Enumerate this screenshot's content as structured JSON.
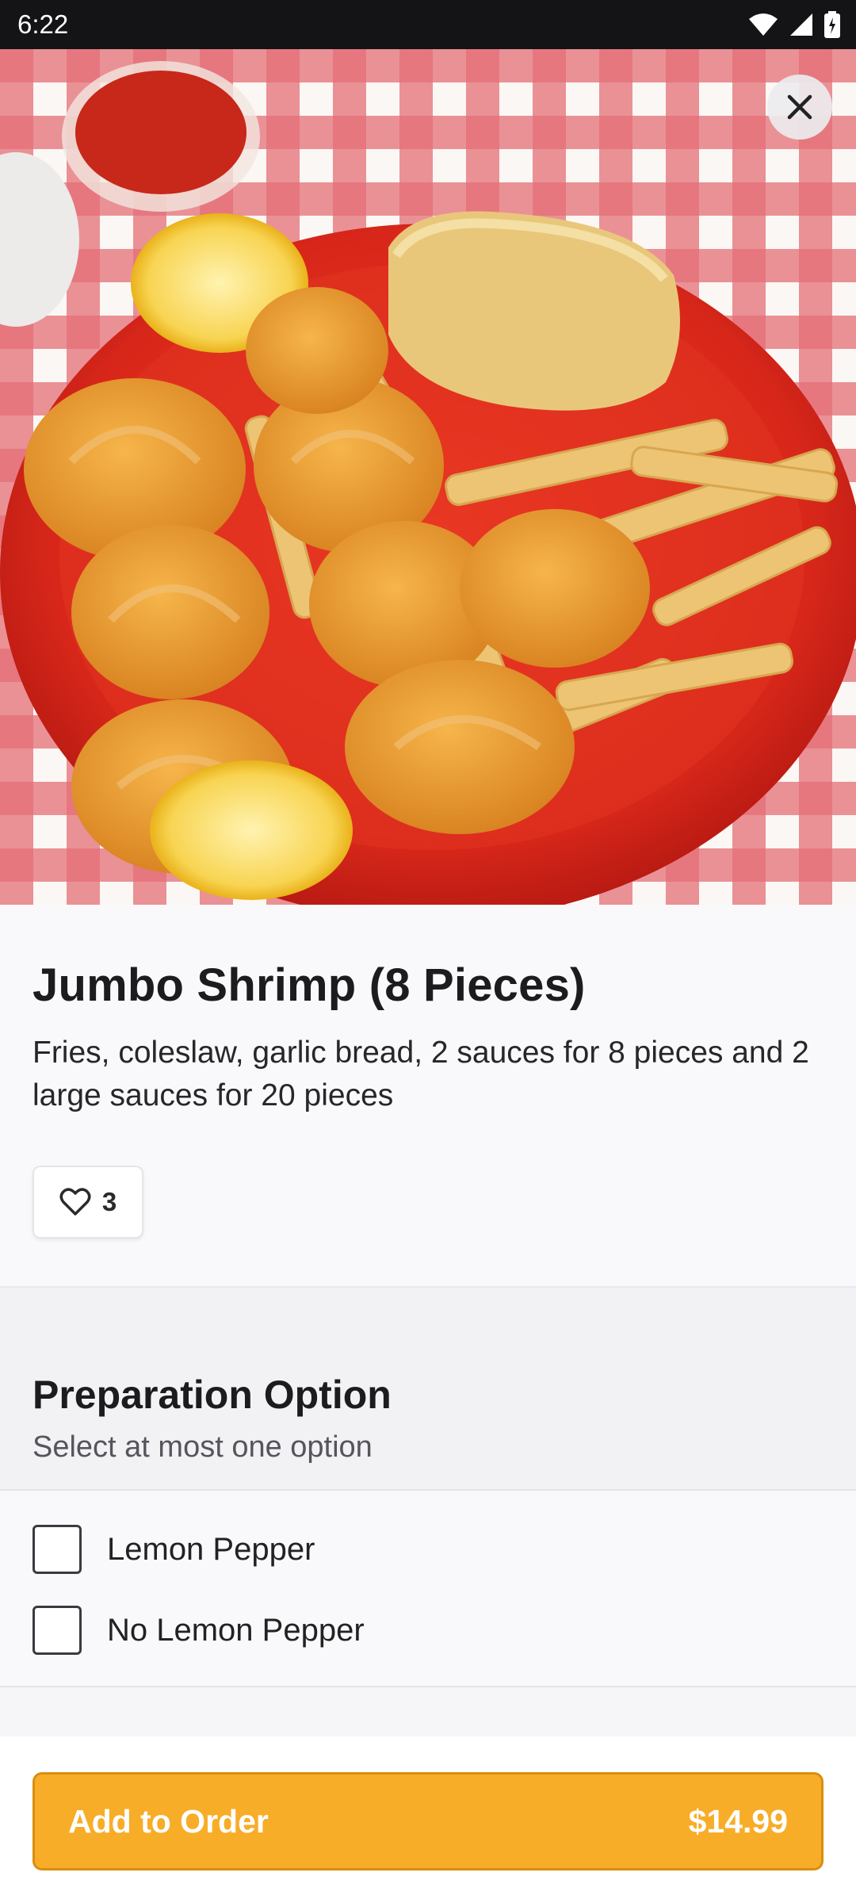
{
  "status_bar": {
    "time": "6:22"
  },
  "item": {
    "title": "Jumbo Shrimp (8 Pieces)",
    "description": "Fries, coleslaw, garlic bread, 2 sauces for 8 pieces and 2 large sauces for 20 pieces",
    "likes": "3"
  },
  "preparation": {
    "title": "Preparation Option",
    "subtitle": "Select at most one option",
    "options": [
      {
        "label": "Lemon Pepper",
        "checked": false
      },
      {
        "label": "No Lemon Pepper",
        "checked": false
      }
    ]
  },
  "order_button": {
    "label": "Add to Order",
    "price": "$14.99"
  },
  "colors": {
    "accent": "#f7ad28",
    "status_bar": "#141416",
    "tablecloth_red": "#d63a44",
    "plate_red": "#e02a1e"
  }
}
